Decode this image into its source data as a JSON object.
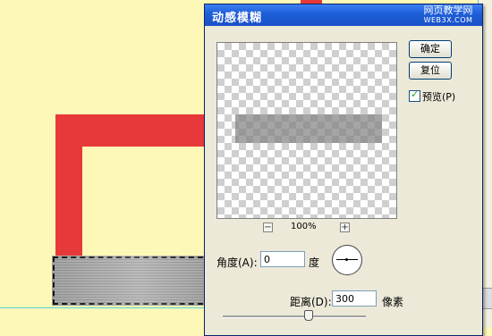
{
  "dialog": {
    "title": "动感模糊",
    "ok_label": "确定",
    "reset_label": "复位",
    "preview_label": "预览(P)",
    "preview_checked": true
  },
  "watermark": {
    "line1": "网页教学网",
    "line2": "WEB3X.COM"
  },
  "preview": {
    "zoom_out_icon": "−",
    "zoom_in_icon": "+",
    "zoom_level": "100%"
  },
  "angle": {
    "label": "角度(A):",
    "value": "0",
    "unit": "度"
  },
  "distance": {
    "label": "距离(D):",
    "value": "300",
    "unit": "像素",
    "slider_fraction": 0.6
  },
  "colors": {
    "canvas": "#fdf8b8",
    "red_shape": "#e8393a",
    "titlebar": "#1f5fd8",
    "dialog_bg": "#ece9d8"
  }
}
